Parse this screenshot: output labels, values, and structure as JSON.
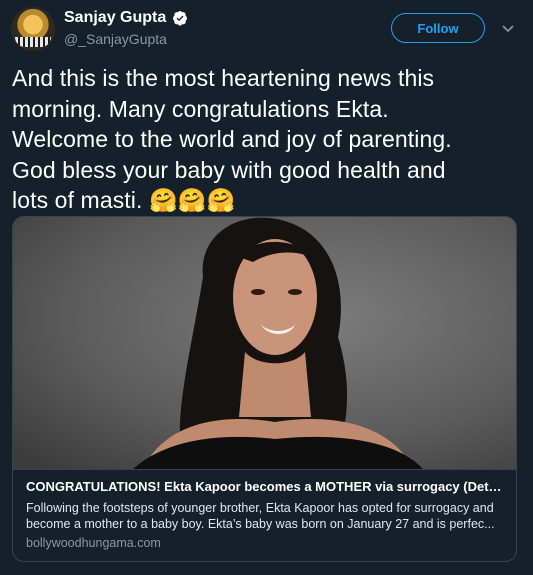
{
  "author": {
    "name": "Sanjay Gupta",
    "handle": "@_SanjayGupta",
    "verified": true
  },
  "follow_label": "Follow",
  "tweet": {
    "lines": [
      "And this is the most heartening news this",
      "morning. Many congratulations Ekta.",
      "Welcome to the world and joy of parenting.",
      "God bless your baby with good health and",
      "lots of masti. 🤗🤗🤗"
    ]
  },
  "card": {
    "title": "CONGRATULATIONS! Ekta Kapoor becomes a MOTHER via surrogacy (Detail…",
    "description_lines": [
      "Following the footsteps of younger brother, Ekta Kapoor has opted for surrogacy and",
      "become a mother to a baby boy. Ekta’s baby was born on January 27 and is perfec..."
    ],
    "domain": "bollywoodhungama.com"
  },
  "colors": {
    "background": "#15202b",
    "accent": "#1da1f2",
    "secondary_text": "#8899a6",
    "border": "#38444d"
  },
  "icons": {
    "verified": "verified-badge-icon",
    "caret": "chevron-down-icon"
  }
}
